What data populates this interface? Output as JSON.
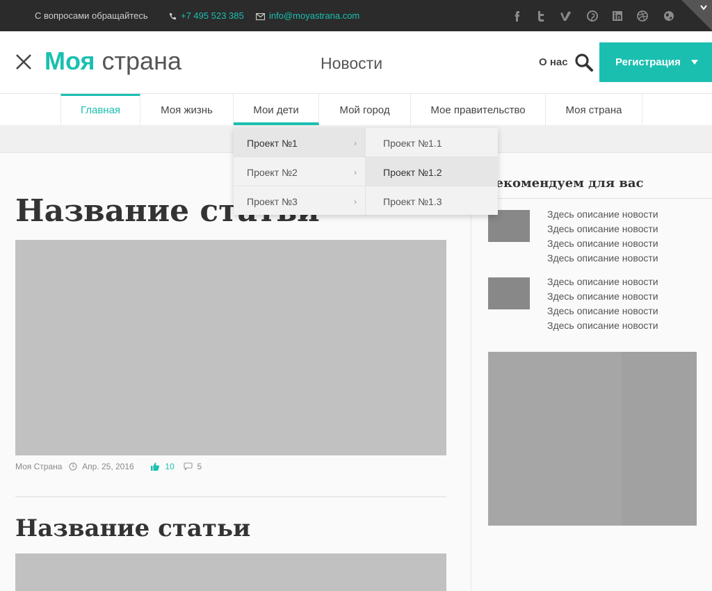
{
  "topbar": {
    "contact_text": "С вопросами обращайтесь",
    "phone": "+7 495 523 385",
    "email": "info@moyastrana.com",
    "socials": [
      "facebook-icon",
      "twitter-icon",
      "vimeo-icon",
      "pinterest-icon",
      "linkedin-icon",
      "dribbble-icon",
      "globe-icon"
    ]
  },
  "header": {
    "logo_bold": "Моя",
    "logo_light": "страна",
    "section_title": "Новости",
    "about_link": "О нас",
    "register_label": "Регистрация"
  },
  "nav": {
    "items": [
      {
        "label": "Главная",
        "state": "active"
      },
      {
        "label": "Моя жизнь"
      },
      {
        "label": "Мои дети",
        "state": "open"
      },
      {
        "label": "Мой город"
      },
      {
        "label": "Мое правительство"
      },
      {
        "label": "Моя страна"
      }
    ]
  },
  "dropdown": {
    "projects": [
      {
        "label": "Проект №1",
        "highlighted": true
      },
      {
        "label": "Проект №2"
      },
      {
        "label": "Проект №3"
      }
    ],
    "subprojects": [
      {
        "label": "Проект №1.1"
      },
      {
        "label": "Проект №1.2",
        "highlighted": true
      },
      {
        "label": "Проект №1.3"
      }
    ]
  },
  "articles": [
    {
      "title": "Название статьи",
      "author": "Моя Страна",
      "date": "Апр. 25, 2016",
      "likes": "10",
      "comments": "5"
    },
    {
      "title": "Название статьи"
    }
  ],
  "sidebar": {
    "title": "Рекомендуем для вас",
    "news": [
      {
        "lines": [
          "Здесь описание новости",
          "Здесь описание новости",
          "Здесь описание новости",
          "Здесь описание новости"
        ]
      },
      {
        "lines": [
          "Здесь описание новости",
          "Здесь описание новости",
          "Здесь описание новости",
          "Здесь описание новости"
        ]
      }
    ]
  },
  "colors": {
    "accent": "#1bbfb0",
    "topbar_bg": "#2b2b2b",
    "placeholder": "#c1c1c1"
  }
}
